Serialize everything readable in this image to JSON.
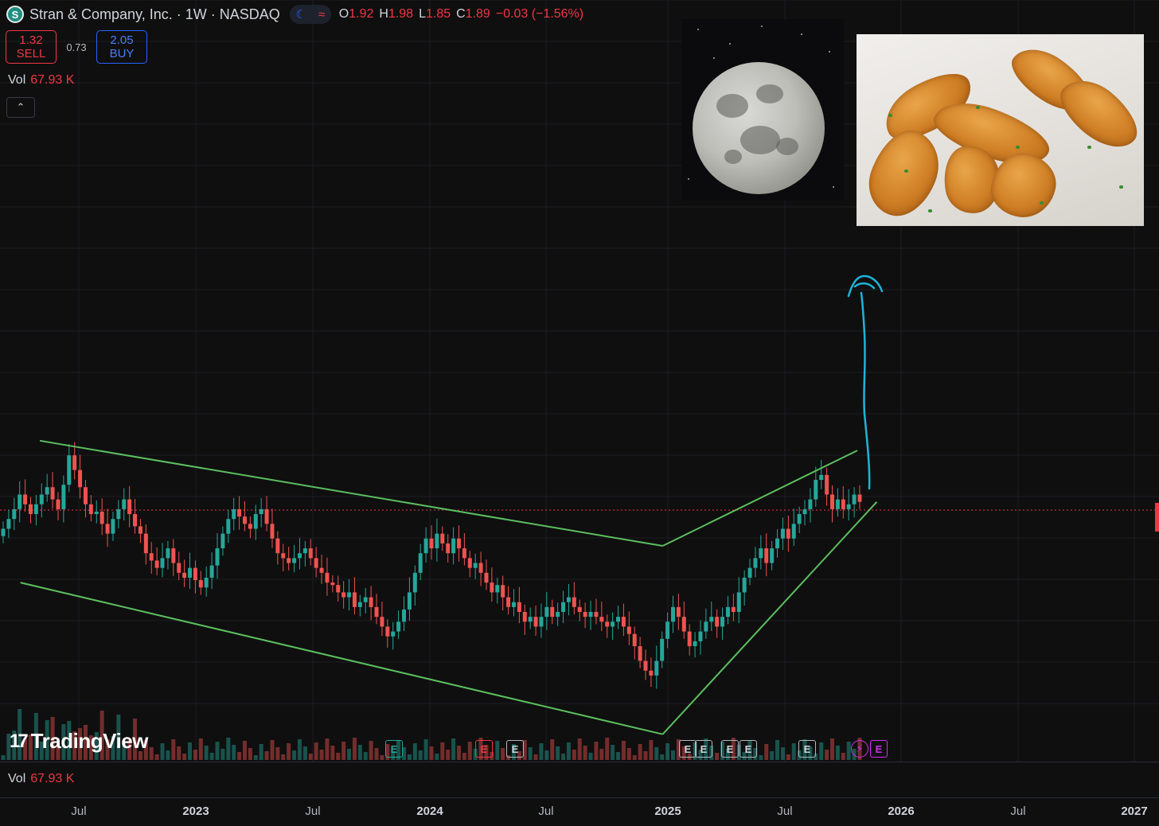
{
  "header": {
    "logo_letter": "S",
    "title": "Stran & Company, Inc. · 1W · NASDAQ",
    "moon_glyph": "☾",
    "wave_glyph": "≈",
    "ohlc": {
      "o_label": "O",
      "o": "1.92",
      "h_label": "H",
      "h": "1.98",
      "l_label": "L",
      "l": "1.85",
      "c_label": "C",
      "c": "1.89",
      "change": "−0.03 (−1.56%)"
    }
  },
  "trade": {
    "sell_price": "1.32",
    "sell_label": "SELL",
    "spread": "0.73",
    "buy_price": "2.05",
    "buy_label": "BUY"
  },
  "volume": {
    "label": "Vol",
    "value": "67.93 K",
    "value_bottom": "67.93 K"
  },
  "collapse_glyph": "⌃",
  "watermark": {
    "icon": "17",
    "text": "TradingView"
  },
  "earnings_markers": [
    {
      "label": "E",
      "kind": "green"
    },
    {
      "label": "E",
      "kind": "red"
    },
    {
      "label": "E",
      "kind": "gray"
    },
    {
      "label": "E",
      "kind": "gray"
    },
    {
      "label": "E",
      "kind": "gray"
    },
    {
      "label": "E",
      "kind": "gray"
    },
    {
      "label": "E",
      "kind": "gray"
    },
    {
      "label": "E",
      "kind": "gray"
    },
    {
      "label": "⚡",
      "kind": "purple"
    },
    {
      "label": "E",
      "kind": "purple"
    }
  ],
  "colors": {
    "up": "#26a69a",
    "down": "#ef5350",
    "trend": "#5cbf5f",
    "arrow": "#1fb4d8",
    "last_price": "#f23645",
    "background": "#0f0f0f"
  },
  "chart_data": {
    "type": "candlestick",
    "timeframe": "1W",
    "x_axis_labels": [
      "Jul",
      "2023",
      "Jul",
      "2024",
      "Jul",
      "2025",
      "Jul",
      "2026",
      "Jul",
      "2027"
    ],
    "x_range": [
      "2022-04",
      "2027-01"
    ],
    "y_range": [
      0.9,
      2.25
    ],
    "last_price": 1.89,
    "grid": true,
    "annotations": [
      {
        "type": "trendline",
        "from": [
          "2022-05",
          2.14
        ],
        "to": [
          "2025-01",
          1.71
        ]
      },
      {
        "type": "trendline",
        "from": [
          "2022-04",
          1.56
        ],
        "to": [
          "2025-01",
          0.94
        ]
      },
      {
        "type": "trendline",
        "from": [
          "2025-01",
          1.71
        ],
        "to": [
          "2025-11",
          2.1
        ]
      },
      {
        "type": "trendline",
        "from": [
          "2025-01",
          0.94
        ],
        "to": [
          "2025-12",
          1.89
        ]
      },
      {
        "type": "arrow",
        "direction": "up",
        "note": "hand-drawn"
      }
    ],
    "series": [
      {
        "type": "candles",
        "values": [
          1.78,
          1.82,
          1.86,
          1.92,
          1.88,
          1.84,
          1.88,
          1.92,
          1.95,
          1.9,
          1.86,
          1.96,
          2.08,
          2.02,
          1.95,
          1.88,
          1.84,
          1.85,
          1.8,
          1.76,
          1.82,
          1.86,
          1.9,
          1.84,
          1.79,
          1.76,
          1.68,
          1.65,
          1.62,
          1.66,
          1.7,
          1.64,
          1.6,
          1.58,
          1.62,
          1.57,
          1.54,
          1.58,
          1.63,
          1.7,
          1.76,
          1.82,
          1.86,
          1.83,
          1.8,
          1.78,
          1.84,
          1.86,
          1.8,
          1.74,
          1.68,
          1.66,
          1.64,
          1.66,
          1.68,
          1.7,
          1.66,
          1.62,
          1.6,
          1.56,
          1.55,
          1.52,
          1.5,
          1.52,
          1.46,
          1.48,
          1.5,
          1.46,
          1.42,
          1.38,
          1.34,
          1.36,
          1.4,
          1.45,
          1.52,
          1.6,
          1.68,
          1.74,
          1.7,
          1.76,
          1.72,
          1.68,
          1.74,
          1.7,
          1.66,
          1.62,
          1.64,
          1.6,
          1.56,
          1.52,
          1.55,
          1.5,
          1.46,
          1.48,
          1.44,
          1.4,
          1.42,
          1.38,
          1.42,
          1.46,
          1.42,
          1.44,
          1.48,
          1.5,
          1.46,
          1.44,
          1.42,
          1.44,
          1.42,
          1.4,
          1.38,
          1.4,
          1.42,
          1.38,
          1.35,
          1.3,
          1.24,
          1.2,
          1.18,
          1.24,
          1.33,
          1.4,
          1.46,
          1.42,
          1.36,
          1.3,
          1.32,
          1.36,
          1.4,
          1.42,
          1.38,
          1.42,
          1.46,
          1.44,
          1.52,
          1.58,
          1.62,
          1.66,
          1.7,
          1.64,
          1.7,
          1.74,
          1.78,
          1.74,
          1.8,
          1.84,
          1.86,
          1.9,
          1.98,
          2.0,
          1.92,
          1.86,
          1.9,
          1.86,
          1.88,
          1.92,
          1.89
        ]
      }
    ]
  }
}
